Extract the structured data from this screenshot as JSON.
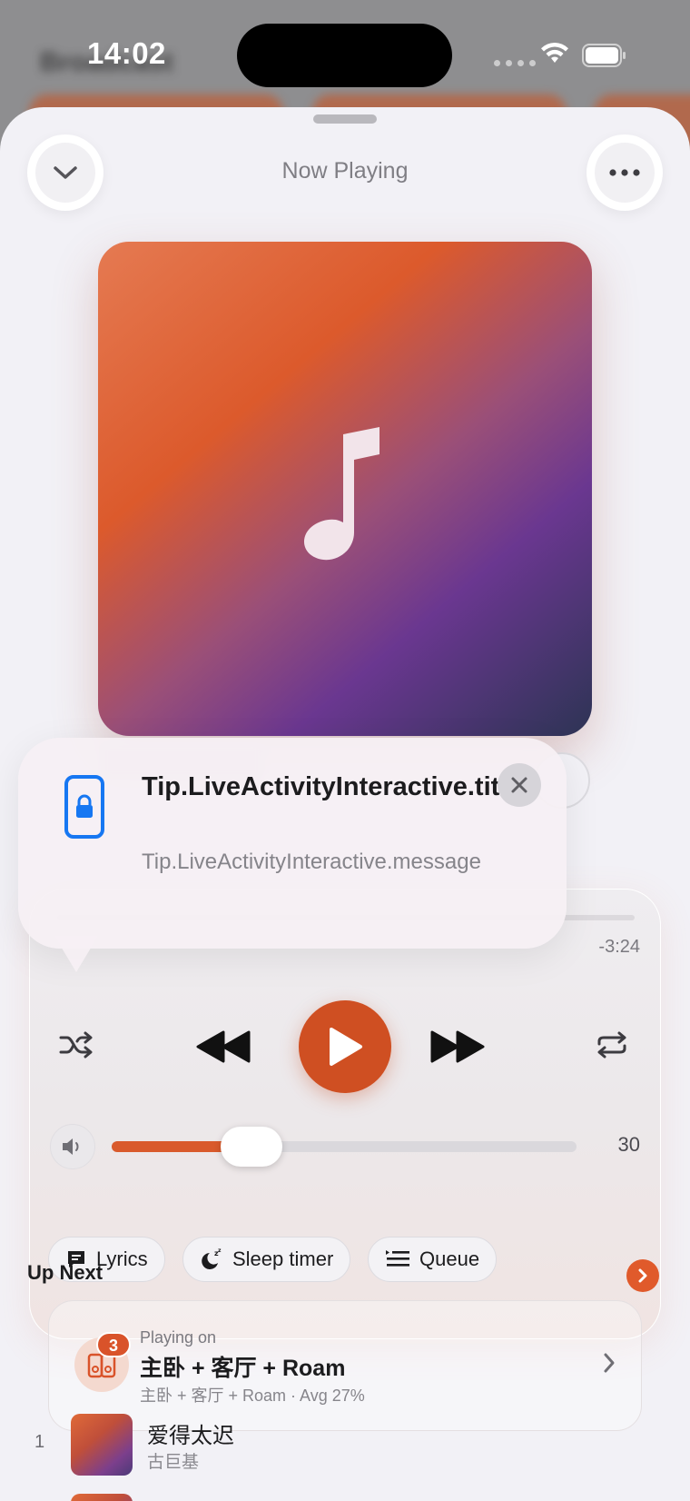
{
  "status_bar": {
    "time": "14:02"
  },
  "background_app": {
    "title": "Broadcast"
  },
  "sheet": {
    "title": "Now Playing"
  },
  "player": {
    "time_remaining": "-3:24",
    "volume": {
      "value": "30",
      "level_percent": 30
    }
  },
  "actions": {
    "lyrics": "Lyrics",
    "sleep_timer": "Sleep timer",
    "queue": "Queue"
  },
  "playing_on": {
    "label": "Playing on",
    "badge": "3",
    "title": "主卧 + 客厅 + Roam",
    "subtitle": "主卧 + 客厅 + Roam · Avg 27%"
  },
  "up_next": {
    "title": "Up Next",
    "items": [
      {
        "index": "1",
        "title": "爱得太迟",
        "artist": "古巨基"
      }
    ]
  },
  "tip": {
    "title": "Tip.LiveActivityInteractive.title",
    "message": "Tip.LiveActivityInteractive.message"
  },
  "colors": {
    "accent": "#D9532A",
    "sheet_bg": "#F2F1F6"
  }
}
